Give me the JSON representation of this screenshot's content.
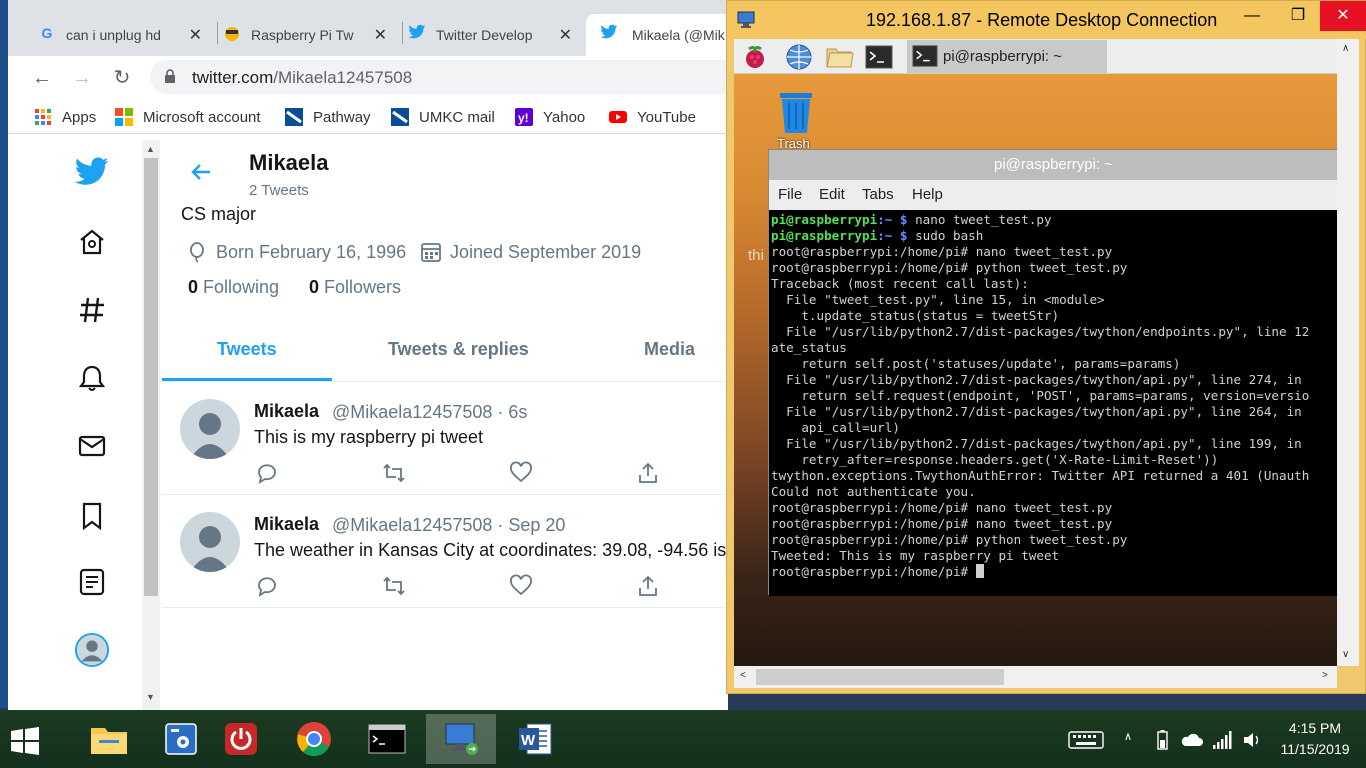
{
  "browser": {
    "tabs": [
      {
        "label": "can i unplug hd"
      },
      {
        "label": "Raspberry Pi Tw"
      },
      {
        "label": "Twitter Develop"
      },
      {
        "label": "Mikaela (@Mik"
      }
    ],
    "url_host": "twitter.com",
    "url_path": "/Mikaela12457508",
    "bookmarks": [
      {
        "label": "Apps"
      },
      {
        "label": "Microsoft account"
      },
      {
        "label": "Pathway"
      },
      {
        "label": "UMKC mail"
      },
      {
        "label": "Yahoo"
      },
      {
        "label": "YouTube"
      }
    ]
  },
  "profile": {
    "name": "Mikaela",
    "tweet_count": "2 Tweets",
    "bio": "CS major",
    "born": "Born February 16, 1996",
    "joined": "Joined September 2019",
    "following_count": "0",
    "following_label": "Following",
    "followers_count": "0",
    "followers_label": "Followers",
    "tabs": [
      {
        "label": "Tweets"
      },
      {
        "label": "Tweets & replies"
      },
      {
        "label": "Media"
      }
    ]
  },
  "tweets": [
    {
      "name": "Mikaela",
      "handle": "@Mikaela12457508 · 6s",
      "text": "This is my raspberry pi tweet"
    },
    {
      "name": "Mikaela",
      "handle": "@Mikaela12457508 · Sep 20",
      "text": "The weather in Kansas City at coordinates: 39.08, -94.56 is"
    }
  ],
  "rdp": {
    "title": "192.168.1.87 - Remote Desktop Connection",
    "taskbar_item": "pi@raspberrypi: ~",
    "trash_label": "Trash",
    "partial_label": "thi",
    "terminal": {
      "title": "pi@raspberrypi: ~",
      "menu": [
        "File",
        "Edit",
        "Tabs",
        "Help"
      ],
      "lines": [
        "root@raspberrypi:/home/pi# nano tweet_test.py",
        "root@raspberrypi:/home/pi# python tweet_test.py",
        "Traceback (most recent call last):",
        "  File \"tweet_test.py\", line 15, in <module>",
        "    t.update_status(status = tweetStr)",
        "  File \"/usr/lib/python2.7/dist-packages/twython/endpoints.py\", line 12",
        "ate_status",
        "    return self.post('statuses/update', params=params)",
        "  File \"/usr/lib/python2.7/dist-packages/twython/api.py\", line 274, in",
        "    return self.request(endpoint, 'POST', params=params, version=versio",
        "  File \"/usr/lib/python2.7/dist-packages/twython/api.py\", line 264, in",
        "    api_call=url)",
        "  File \"/usr/lib/python2.7/dist-packages/twython/api.py\", line 199, in",
        "    retry_after=response.headers.get('X-Rate-Limit-Reset'))",
        "twython.exceptions.TwythonAuthError: Twitter API returned a 401 (Unauth",
        "Could not authenticate you.",
        "root@raspberrypi:/home/pi# nano tweet_test.py",
        "root@raspberrypi:/home/pi# nano tweet_test.py",
        "root@raspberrypi:/home/pi# python tweet_test.py",
        "Tweeted: This is my raspberry pi tweet"
      ],
      "prompt_user": "pi@raspberrypi",
      "prompt_path": ":~ $",
      "cmd1": " nano tweet_test.py",
      "cmd2": " sudo bash",
      "last_prompt": "root@raspberrypi:/home/pi# "
    }
  },
  "taskbar": {
    "time": "4:15 PM",
    "date": "11/15/2019"
  },
  "colors": {
    "twitter_blue": "#1da1f2",
    "rdp_title": "#f3c660",
    "close_red": "#e81123"
  }
}
